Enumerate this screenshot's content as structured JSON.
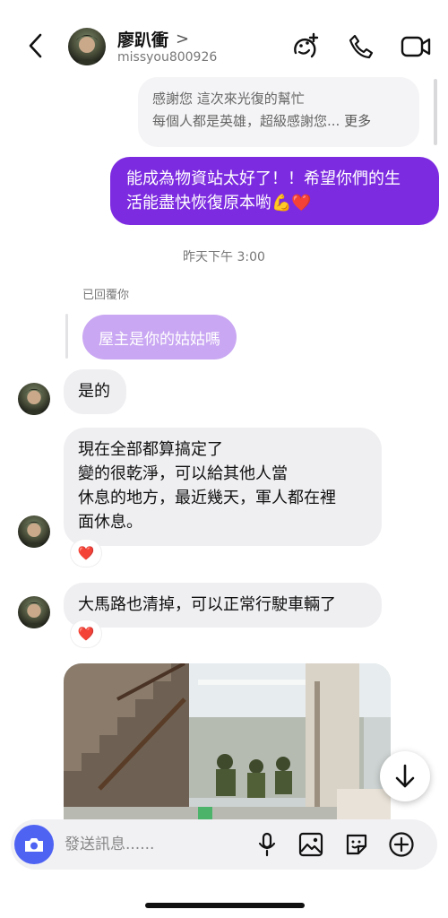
{
  "header": {
    "name": "廖趴衝",
    "chevron": ">",
    "username": "missyou800926",
    "icons": [
      "back-arrow-icon",
      "effects-icon",
      "phone-icon",
      "video-icon"
    ]
  },
  "messages": {
    "quoted_line1": "感謝您 這次來光復的幫忙",
    "quoted_line2": "每個人都是英雄，超級感謝您...",
    "quoted_more": "更多",
    "sent_line1": "能成為物資站太好了！！希望你們的生",
    "sent_line2": "活能盡快恢復原本喲💪❤️",
    "timestamp": "昨天下午 3:00",
    "reply_label": "已回覆你",
    "reply_text": "屋主是你的姑姑嗎",
    "msg_yes": "是的",
    "msg_done_line1": "現在全部都算搞定了",
    "msg_done_line2": "變的很乾淨，可以給其他人當",
    "msg_done_line3": "休息的地方，最近幾天，軍人都在裡",
    "msg_done_line4": "面休息。",
    "msg_road": "大馬路也清掉，可以正常行駛車輛了",
    "reaction": "❤️"
  },
  "composer": {
    "placeholder": "發送訊息......",
    "icons": [
      "camera-icon",
      "microphone-icon",
      "gallery-icon",
      "sticker-icon",
      "add-icon"
    ]
  },
  "colors": {
    "accent": "#7d2be0",
    "reply_bubble": "#c9a7f2",
    "camera_button": "#4f63f3",
    "received_bubble": "#efeff2"
  }
}
